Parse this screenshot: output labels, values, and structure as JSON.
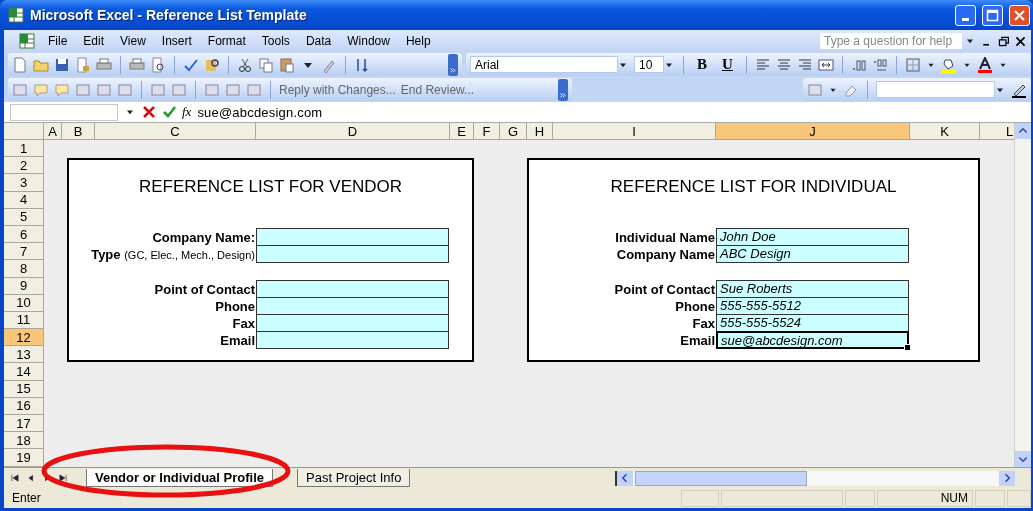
{
  "window": {
    "title": "Microsoft Excel - Reference List Template"
  },
  "menu": [
    {
      "label": "File"
    },
    {
      "label": "Edit"
    },
    {
      "label": "View"
    },
    {
      "label": "Insert"
    },
    {
      "label": "Format"
    },
    {
      "label": "Tools"
    },
    {
      "label": "Data"
    },
    {
      "label": "Window"
    },
    {
      "label": "Help"
    }
  ],
  "help_box": {
    "placeholder": "Type a question for help"
  },
  "formatting": {
    "font": "Arial",
    "size": "10",
    "bold_button": "B",
    "underline_button": "U"
  },
  "review": {
    "reply": "Reply with Changes...",
    "end": "End Review..."
  },
  "formula_bar": {
    "fx": "fx",
    "value": "sue@abcdesign.com"
  },
  "columns": [
    {
      "label": "A",
      "selected": false
    },
    {
      "label": "B",
      "selected": false
    },
    {
      "label": "C",
      "selected": false
    },
    {
      "label": "D",
      "selected": false
    },
    {
      "label": "E",
      "selected": false
    },
    {
      "label": "F",
      "selected": false
    },
    {
      "label": "G",
      "selected": false
    },
    {
      "label": "H",
      "selected": false
    },
    {
      "label": "I",
      "selected": false
    },
    {
      "label": "J",
      "selected": true
    },
    {
      "label": "K",
      "selected": false
    },
    {
      "label": "L",
      "selected": false
    }
  ],
  "rows": [
    {
      "label": "1",
      "selected": false
    },
    {
      "label": "2",
      "selected": false
    },
    {
      "label": "3",
      "selected": false
    },
    {
      "label": "4",
      "selected": false
    },
    {
      "label": "5",
      "selected": false
    },
    {
      "label": "6",
      "selected": false
    },
    {
      "label": "7",
      "selected": false
    },
    {
      "label": "8",
      "selected": false
    },
    {
      "label": "9",
      "selected": false
    },
    {
      "label": "10",
      "selected": false
    },
    {
      "label": "11",
      "selected": false
    },
    {
      "label": "12",
      "selected": true
    },
    {
      "label": "13",
      "selected": false
    },
    {
      "label": "14",
      "selected": false
    },
    {
      "label": "15",
      "selected": false
    },
    {
      "label": "16",
      "selected": false
    },
    {
      "label": "17",
      "selected": false
    },
    {
      "label": "18",
      "selected": false
    },
    {
      "label": "19",
      "selected": false
    }
  ],
  "cards": [
    {
      "title": "REFERENCE LIST FOR VENDOR",
      "groups": [
        [
          {
            "label": "Company Name:",
            "selected": false
          },
          {
            "label": "**Type** (GC, Elec., Mech., Design)",
            "selected": false
          }
        ],
        [
          {
            "label": "Point of Contact",
            "selected": false
          },
          {
            "label": "Phone",
            "selected": false
          },
          {
            "label": "Fax",
            "selected": false
          },
          {
            "label": "Email",
            "selected": false
          }
        ]
      ]
    },
    {
      "title": "REFERENCE LIST FOR INDIVIDUAL",
      "groups": [
        [
          {
            "label": "Individual Name",
            "value": "John Doe",
            "selected": false
          },
          {
            "label": "Company Name",
            "value": "ABC Design",
            "selected": false
          }
        ],
        [
          {
            "label": "Point of Contact",
            "value": "Sue Roberts",
            "selected": false
          },
          {
            "label": "Phone",
            "value": "555-555-5512",
            "selected": false
          },
          {
            "label": "Fax",
            "value": "555-555-5524",
            "selected": false
          },
          {
            "label": "Email",
            "value": "sue@abcdesign.com",
            "selected": true
          }
        ]
      ]
    }
  ],
  "sheet_tabs": [
    {
      "label": "Vendor or Individual Profile",
      "selected": true
    },
    {
      "label": "Past Project Info",
      "selected": false
    }
  ],
  "status_bar": {
    "mode": "Enter",
    "num": "NUM"
  }
}
